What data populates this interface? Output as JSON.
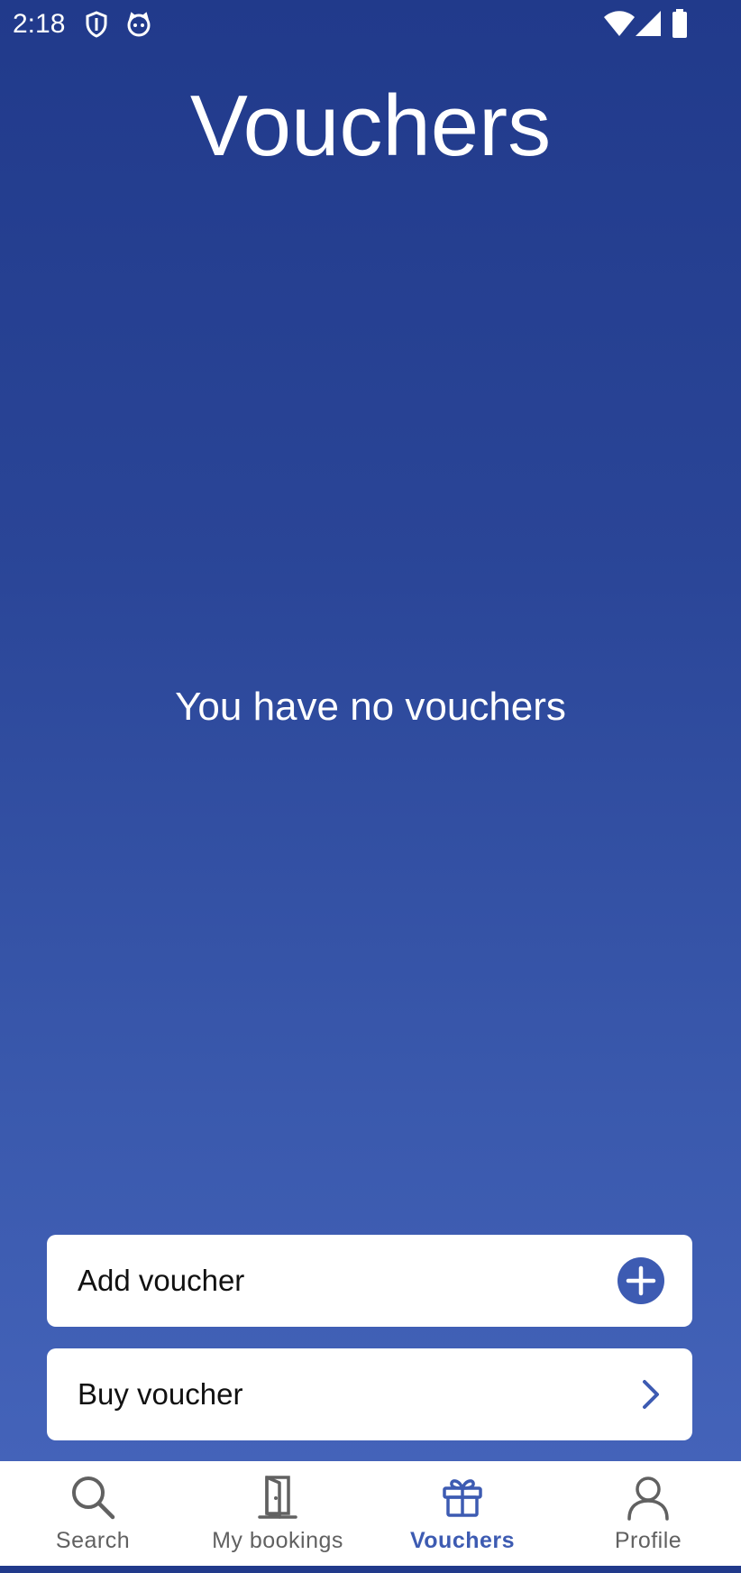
{
  "status_bar": {
    "time": "2:18",
    "icons": [
      "shield-icon",
      "cat-face-icon",
      "wifi-icon",
      "cell-signal-icon",
      "battery-icon"
    ]
  },
  "page": {
    "title": "Vouchers",
    "empty_message": "You have no vouchers"
  },
  "actions": {
    "add_voucher_label": "Add voucher",
    "add_voucher_icon": "plus-circle-icon",
    "buy_voucher_label": "Buy voucher",
    "buy_voucher_icon": "chevron-right-icon"
  },
  "bottom_nav": {
    "items": [
      {
        "label": "Search",
        "icon": "search-icon",
        "active": false
      },
      {
        "label": "My bookings",
        "icon": "door-icon",
        "active": false
      },
      {
        "label": "Vouchers",
        "icon": "gift-icon",
        "active": true
      },
      {
        "label": "Profile",
        "icon": "person-icon",
        "active": false
      }
    ]
  },
  "colors": {
    "background_top": "#213a8b",
    "background_bottom": "#4766bd",
    "accent": "#3d5bb2",
    "card": "#ffffff",
    "nav_inactive": "#616161"
  }
}
